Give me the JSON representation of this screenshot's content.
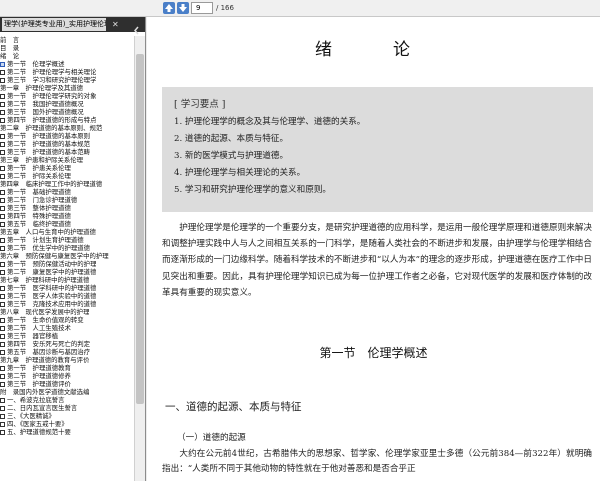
{
  "toolbar": {
    "page_number": "9",
    "page_total": "/ 166"
  },
  "left_panel": {
    "tab_label": "理学(护理类专业用)_实用护理伦理学_文字版",
    "outline": [
      {
        "text": "前　言",
        "icon": "none"
      },
      {
        "text": "目　录",
        "icon": "none"
      },
      {
        "text": "绪　论",
        "icon": "none"
      },
      {
        "text": "第一节　伦理学概述",
        "icon": "blue"
      },
      {
        "text": "第二节　护理伦理学与相关理论",
        "icon": "box"
      },
      {
        "text": "第三节　学习和研究护理伦理学",
        "icon": "box"
      },
      {
        "text": "第一章　护理伦理学及其道德",
        "icon": "none"
      },
      {
        "text": "第一节　护理伦理学研究的对象",
        "icon": "box"
      },
      {
        "text": "第二节　我国护理道德概况",
        "icon": "box"
      },
      {
        "text": "第三节　国外护理道德概况",
        "icon": "box"
      },
      {
        "text": "第四节　护理道德的形成与特点",
        "icon": "box"
      },
      {
        "text": "第二章　护理道德的基本原则、规范",
        "icon": "none"
      },
      {
        "text": "第一节　护理道德的基本原则",
        "icon": "box"
      },
      {
        "text": "第二节　护理道德的基本规范",
        "icon": "box"
      },
      {
        "text": "第三节　护理道德的基本范畴",
        "icon": "box"
      },
      {
        "text": "第三章　护患和护际关系伦理",
        "icon": "none"
      },
      {
        "text": "第一节　护患关系伦理",
        "icon": "box"
      },
      {
        "text": "第二节　护际关系伦理",
        "icon": "box"
      },
      {
        "text": "第四章　临床护理工作中的护理道德",
        "icon": "none"
      },
      {
        "text": "第一节　基础护理道德",
        "icon": "box"
      },
      {
        "text": "第二节　门急诊护理道德",
        "icon": "box"
      },
      {
        "text": "第三节　整体护理道德",
        "icon": "box"
      },
      {
        "text": "第四节　特殊护理道德",
        "icon": "box"
      },
      {
        "text": "第五节　临终护理道德",
        "icon": "box"
      },
      {
        "text": "第五章　人口与生育中的护理道德",
        "icon": "none"
      },
      {
        "text": "第一节　计划生育护理道德",
        "icon": "box"
      },
      {
        "text": "第二节　优生学中的护理道德",
        "icon": "box"
      },
      {
        "text": "第六章　预防保健与康复医学中的护理",
        "icon": "none"
      },
      {
        "text": "第一节　预防保健活动中的护理",
        "icon": "box"
      },
      {
        "text": "第二节　康复医学中的护理道德",
        "icon": "box"
      },
      {
        "text": "第七章　护理科研中的护理道德",
        "icon": "none"
      },
      {
        "text": "第一节　医学科研中的护理道德",
        "icon": "box"
      },
      {
        "text": "第二节　医学人体实验中的道德",
        "icon": "box"
      },
      {
        "text": "第三节　克隆技术应用中的道德",
        "icon": "box"
      },
      {
        "text": "第八章　现代医学发展中的护理",
        "icon": "none"
      },
      {
        "text": "第一节　生命价值观的转变",
        "icon": "box"
      },
      {
        "text": "第二节　人工生殖技术",
        "icon": "box"
      },
      {
        "text": "第三节　器官移植",
        "icon": "box"
      },
      {
        "text": "第四节　安乐死与死亡的判定",
        "icon": "box"
      },
      {
        "text": "第五节　基因诊断与基因治疗",
        "icon": "box"
      },
      {
        "text": "第九章　护理道德的教育与评价",
        "icon": "none"
      },
      {
        "text": "第一节　护理道德教育",
        "icon": "box"
      },
      {
        "text": "第二节　护理道德修养",
        "icon": "box"
      },
      {
        "text": "第三节　护理道德评价",
        "icon": "box"
      },
      {
        "text": "附　录国内外医学道德文献选编",
        "icon": "none"
      },
      {
        "text": "一、希波克拉底誓言",
        "icon": "box"
      },
      {
        "text": "二、日内瓦宣言医生誓言",
        "icon": "box"
      },
      {
        "text": "三、《大医精诚》",
        "icon": "box"
      },
      {
        "text": "四、《医家五戒十要》",
        "icon": "box"
      },
      {
        "text": "五、护理道德规范十要",
        "icon": "box"
      }
    ]
  },
  "document": {
    "title": "绪　论",
    "summary_heading": "[ 学习要点 ]",
    "summary_items": [
      "1. 护理伦理学的概念及其与伦理学、道德的关系。",
      "2. 道德的起源、本质与特征。",
      "3. 新的医学模式与护理道德。",
      "4. 护理伦理学与相关理论的关系。",
      "5. 学习和研究护理伦理学的意义和原则。"
    ],
    "paragraph1": "　　护理伦理学是伦理学的一个重要分支，是研究护理道德的应用科学，是运用一般伦理学原理和道德原则来解决和调整护理实践中人与人之间相互关系的一门科学，是随着人类社会的不断进步和发展，由护理学与伦理学相结合而逐渐形成的一门边缘科学。随着科学技术的不断进步和“以人为本”的理念的逐步形成，护理道德在医疗工作中日见突出和重要。因此，具有护理伦理学知识已成为每一位护理工作者之必备，它对现代医学的发展和医疗体制的改革具有重要的现实意义。",
    "section_title": "第一节　伦理学概述",
    "subsection1": "一、道德的起源、本质与特征",
    "subsection2": "（一）道德的起源",
    "paragraph2": "　　大约在公元前4世纪，古希腊伟大的思想家、哲学家、伦理学家亚里士多德（公元前384—前322年）就明确指出：“人类所不同于其他动物的特性就在于他对善恶和是否合乎正"
  }
}
